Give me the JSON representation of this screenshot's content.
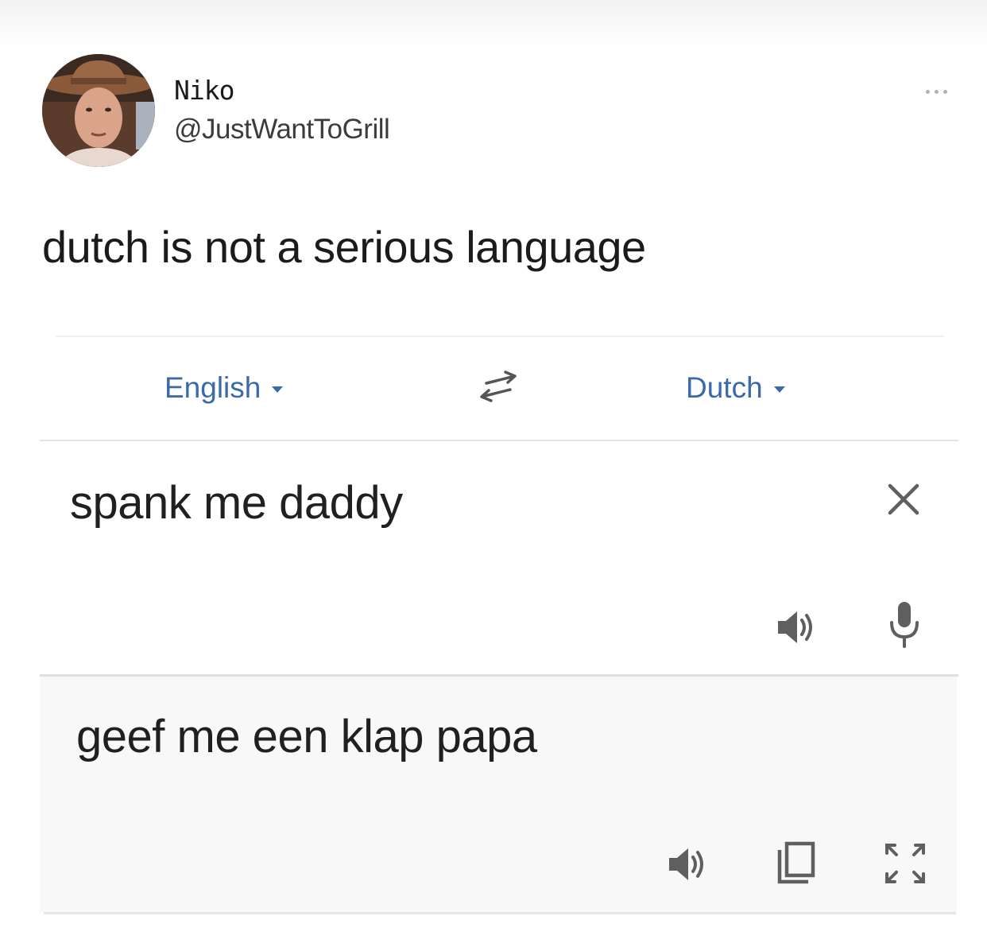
{
  "tweet": {
    "display_name": "Niko",
    "handle": "@JustWantToGrill",
    "text": "dutch is not a serious language",
    "more_icon": "more-horizontal-icon"
  },
  "translator": {
    "source_language": "English",
    "target_language": "Dutch",
    "swap_icon": "swap-arrows-icon",
    "source_text": "spank me daddy",
    "translated_text": "geef me een klap papa",
    "source_icons": [
      "close-icon",
      "speaker-icon",
      "microphone-icon"
    ],
    "target_icons": [
      "speaker-icon",
      "copy-icon",
      "fullscreen-icon"
    ]
  },
  "colors": {
    "link": "#3b6aa8",
    "text": "#202020",
    "icon": "#5f5f5f",
    "target_bg": "#f8f8f8"
  }
}
